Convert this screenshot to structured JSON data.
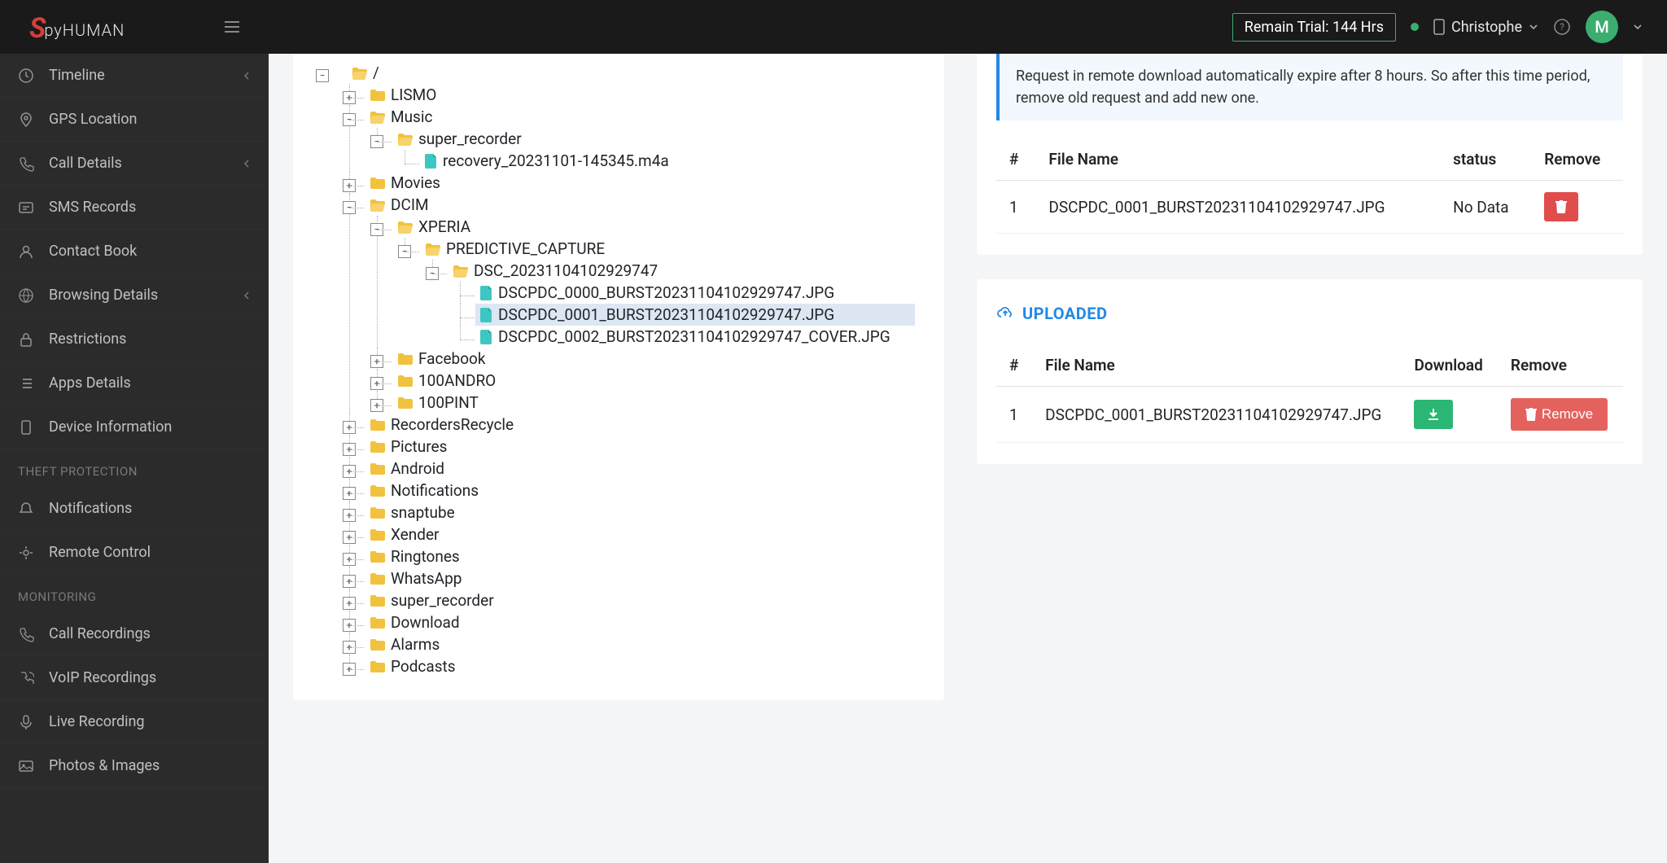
{
  "header": {
    "logo_prefix": "S",
    "logo_rest": "pyHUMAN",
    "trial_text": "Remain Trial: 144 Hrs",
    "user_name": "Christophe",
    "avatar_initial": "M"
  },
  "sidebar": {
    "groups": [
      {
        "heading": null,
        "items": [
          {
            "label": "Timeline",
            "icon": "clock",
            "chevron": true
          },
          {
            "label": "GPS Location",
            "icon": "pin",
            "chevron": false
          },
          {
            "label": "Call Details",
            "icon": "phone",
            "chevron": true
          },
          {
            "label": "SMS Records",
            "icon": "sms",
            "chevron": false
          },
          {
            "label": "Contact Book",
            "icon": "user",
            "chevron": false
          },
          {
            "label": "Browsing Details",
            "icon": "globe",
            "chevron": true
          },
          {
            "label": "Restrictions",
            "icon": "lock",
            "chevron": false
          },
          {
            "label": "Apps Details",
            "icon": "list",
            "chevron": false
          },
          {
            "label": "Device Information",
            "icon": "device",
            "chevron": false
          }
        ]
      },
      {
        "heading": "THEFT PROTECTION",
        "items": [
          {
            "label": "Notifications",
            "icon": "bell",
            "chevron": false
          },
          {
            "label": "Remote Control",
            "icon": "remote",
            "chevron": false
          }
        ]
      },
      {
        "heading": "MONITORING",
        "items": [
          {
            "label": "Call Recordings",
            "icon": "phone2",
            "chevron": false
          },
          {
            "label": "VoIP Recordings",
            "icon": "voip",
            "chevron": false
          },
          {
            "label": "Live Recording",
            "icon": "mic",
            "chevron": false
          },
          {
            "label": "Photos & Images",
            "icon": "image",
            "chevron": false
          }
        ]
      }
    ]
  },
  "tree": {
    "root": "/",
    "children": [
      {
        "name": "LISMO",
        "type": "folder",
        "expanded": false
      },
      {
        "name": "Music",
        "type": "folder",
        "expanded": true,
        "children": [
          {
            "name": "super_recorder",
            "type": "folder",
            "expanded": true,
            "children": [
              {
                "name": "recovery_20231101-145345.m4a",
                "type": "file"
              }
            ]
          }
        ]
      },
      {
        "name": "Movies",
        "type": "folder",
        "expanded": false
      },
      {
        "name": "DCIM",
        "type": "folder",
        "expanded": true,
        "children": [
          {
            "name": "XPERIA",
            "type": "folder",
            "expanded": true,
            "children": [
              {
                "name": "PREDICTIVE_CAPTURE",
                "type": "folder",
                "expanded": true,
                "children": [
                  {
                    "name": "DSC_20231104102929747",
                    "type": "folder",
                    "expanded": true,
                    "children": [
                      {
                        "name": "DSCPDC_0000_BURST20231104102929747.JPG",
                        "type": "file"
                      },
                      {
                        "name": "DSCPDC_0001_BURST20231104102929747.JPG",
                        "type": "file",
                        "selected": true
                      },
                      {
                        "name": "DSCPDC_0002_BURST20231104102929747_COVER.JPG",
                        "type": "file"
                      }
                    ]
                  }
                ]
              }
            ]
          },
          {
            "name": "Facebook",
            "type": "folder",
            "expanded": false
          },
          {
            "name": "100ANDRO",
            "type": "folder",
            "expanded": false
          },
          {
            "name": "100PINT",
            "type": "folder",
            "expanded": false
          }
        ]
      },
      {
        "name": "RecordersRecycle",
        "type": "folder",
        "expanded": false
      },
      {
        "name": "Pictures",
        "type": "folder",
        "expanded": false
      },
      {
        "name": "Android",
        "type": "folder",
        "expanded": false
      },
      {
        "name": "Notifications",
        "type": "folder",
        "expanded": false
      },
      {
        "name": "snaptube",
        "type": "folder",
        "expanded": false
      },
      {
        "name": "Xender",
        "type": "folder",
        "expanded": false
      },
      {
        "name": "Ringtones",
        "type": "folder",
        "expanded": false
      },
      {
        "name": "WhatsApp",
        "type": "folder",
        "expanded": false
      },
      {
        "name": "super_recorder",
        "type": "folder",
        "expanded": false
      },
      {
        "name": "Download",
        "type": "folder",
        "expanded": false
      },
      {
        "name": "Alarms",
        "type": "folder",
        "expanded": false
      },
      {
        "name": "Podcasts",
        "type": "folder",
        "expanded": false
      }
    ]
  },
  "info_note": "Request in remote download automatically expire after 8 hours. So after this time period, remove old request and add new one.",
  "pending_table": {
    "columns": {
      "num": "#",
      "name": "File Name",
      "status": "status",
      "remove": "Remove"
    },
    "rows": [
      {
        "num": "1",
        "name": "DSCPDC_0001_BURST20231104102929747.JPG",
        "status": "No Data"
      }
    ]
  },
  "uploaded_section": {
    "title": "UPLOADED",
    "columns": {
      "num": "#",
      "name": "File Name",
      "download": "Download",
      "remove": "Remove"
    },
    "rows": [
      {
        "num": "1",
        "name": "DSCPDC_0001_BURST20231104102929747.JPG",
        "remove_label": "Remove"
      }
    ]
  }
}
